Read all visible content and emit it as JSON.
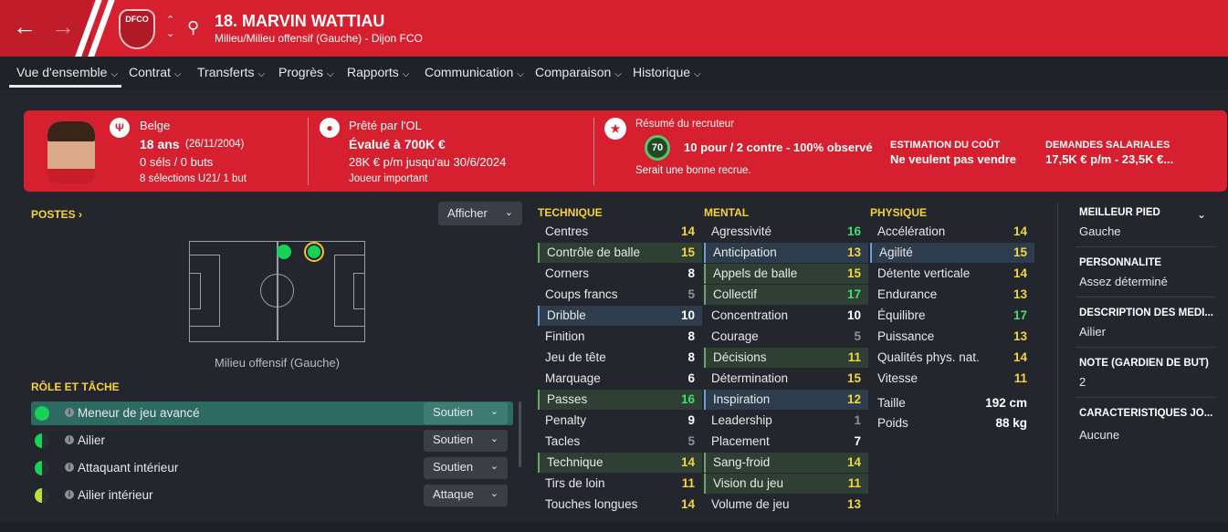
{
  "header": {
    "player_title": "18. MARVIN WATTIAU",
    "player_subtitle": "Milieu/Milieu offensif (Gauche) - Dijon FCO",
    "crest_text": "DFCO",
    "colors": {
      "accent": "#d6202f",
      "menu_bg": "#1f2228",
      "page_bg": "#23262d"
    }
  },
  "menu": {
    "items": [
      {
        "label": "Vue d'ensemble"
      },
      {
        "label": "Contrat"
      },
      {
        "label": "Transferts"
      },
      {
        "label": "Progrès"
      },
      {
        "label": "Rapports"
      },
      {
        "label": "Communication"
      },
      {
        "label": "Comparaison"
      },
      {
        "label": "Historique"
      }
    ],
    "chevron": "⌄"
  },
  "banner": {
    "nationality": "Belge",
    "age": "18 ans",
    "birth": "(26/11/2004)",
    "caps": "0 séls / 0 buts",
    "u21": "8 sélections U21/ 1 but",
    "loan": "Prêté par l'OL",
    "value": "Évalué à 700K €",
    "wage": "28K € p/m jusqu'au 30/6/2024",
    "status": "Joueur important",
    "scout_title": "Résumé du recruteur",
    "scout_score": "70",
    "scout_summary": "10 pour / 2 contre - 100% observé",
    "scout_note": "Serait une bonne recrue.",
    "cost_label": "ESTIMATION DU COÛT",
    "cost_value": "Ne veulent pas vendre",
    "salary_label": "DEMANDES SALARIALES",
    "salary_value": "17,5K € p/m - 23,5K €..."
  },
  "positions": {
    "title": "POSTES ›",
    "afficher": "Afficher",
    "label": "Milieu offensif (Gauche)"
  },
  "roles": {
    "title": "RÔLE ET TÂCHE",
    "items": [
      {
        "name": "Meneur de jeu avancé",
        "duty": "Soutien"
      },
      {
        "name": "Ailier",
        "duty": "Soutien"
      },
      {
        "name": "Attaquant intérieur",
        "duty": "Soutien"
      },
      {
        "name": "Ailier intérieur",
        "duty": "Attaque"
      }
    ]
  },
  "attributes": {
    "technique_title": "TECHNIQUE",
    "mental_title": "MENTAL",
    "physique_title": "PHYSIQUE",
    "technique": [
      {
        "name": "Centres",
        "value": "14"
      },
      {
        "name": "Contrôle de balle",
        "value": "15"
      },
      {
        "name": "Corners",
        "value": "8"
      },
      {
        "name": "Coups francs",
        "value": "5"
      },
      {
        "name": "Dribble",
        "value": "10"
      },
      {
        "name": "Finition",
        "value": "8"
      },
      {
        "name": "Jeu de tête",
        "value": "8"
      },
      {
        "name": "Marquage",
        "value": "6"
      },
      {
        "name": "Passes",
        "value": "16"
      },
      {
        "name": "Penalty",
        "value": "9"
      },
      {
        "name": "Tacles",
        "value": "5"
      },
      {
        "name": "Technique",
        "value": "14"
      },
      {
        "name": "Tirs de loin",
        "value": "11"
      },
      {
        "name": "Touches longues",
        "value": "14"
      }
    ],
    "mental": [
      {
        "name": "Agressivité",
        "value": "16"
      },
      {
        "name": "Anticipation",
        "value": "13"
      },
      {
        "name": "Appels de balle",
        "value": "15"
      },
      {
        "name": "Collectif",
        "value": "17"
      },
      {
        "name": "Concentration",
        "value": "10"
      },
      {
        "name": "Courage",
        "value": "5"
      },
      {
        "name": "Décisions",
        "value": "11"
      },
      {
        "name": "Détermination",
        "value": "15"
      },
      {
        "name": "Inspiration",
        "value": "12"
      },
      {
        "name": "Leadership",
        "value": "1"
      },
      {
        "name": "Placement",
        "value": "7"
      },
      {
        "name": "Sang-froid",
        "value": "14"
      },
      {
        "name": "Vision du jeu",
        "value": "11"
      },
      {
        "name": "Volume de jeu",
        "value": "13"
      }
    ],
    "physique": [
      {
        "name": "Accélération",
        "value": "14"
      },
      {
        "name": "Agilité",
        "value": "15"
      },
      {
        "name": "Détente verticale",
        "value": "14"
      },
      {
        "name": "Endurance",
        "value": "13"
      },
      {
        "name": "Équilibre",
        "value": "17"
      },
      {
        "name": "Puissance",
        "value": "13"
      },
      {
        "name": "Qualités phys. nat.",
        "value": "14"
      },
      {
        "name": "Vitesse",
        "value": "11"
      }
    ],
    "height_label": "Taille",
    "height_value": "192 cm",
    "weight_label": "Poids",
    "weight_value": "88 kg"
  },
  "side": {
    "foot_label": "MEILLEUR PIED",
    "foot_value": "Gauche",
    "personality_label": "PERSONNALITÉ",
    "personality_value": "Assez déterminé",
    "media_label": "DESCRIPTION DES MÉDI...",
    "media_value": "Ailier",
    "gk_label": "NOTE (GARDIEN DE BUT)",
    "gk_value": "2",
    "traits_label": "CARACTÉRISTIQUES JO...",
    "traits_value": "Aucune"
  }
}
